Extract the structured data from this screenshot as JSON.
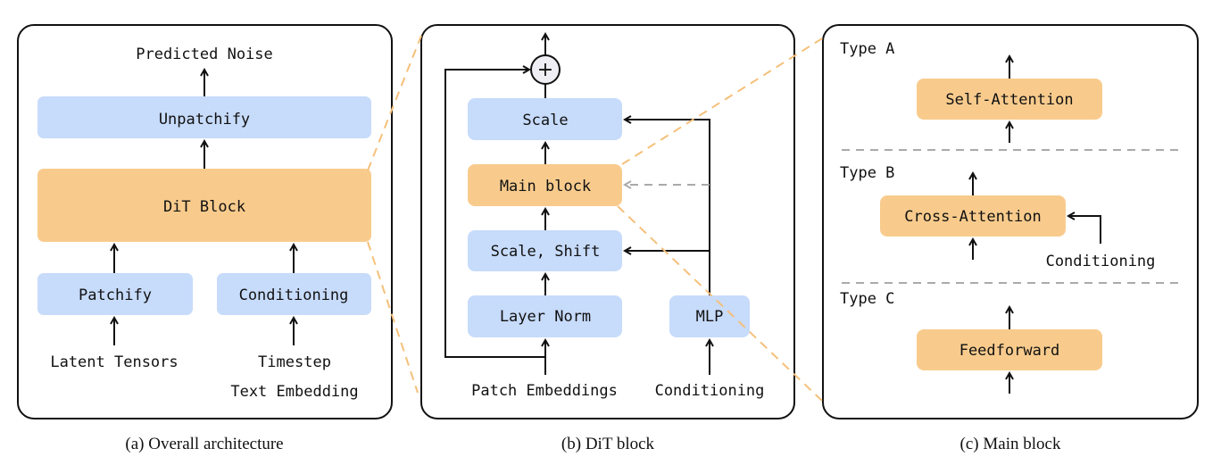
{
  "panel_a": {
    "caption": "(a) Overall architecture",
    "output_label": "Predicted Noise",
    "unpatchify": "Unpatchify",
    "dit_block": "DiT Block",
    "patchify": "Patchify",
    "conditioning": "Conditioning",
    "input_latent": "Latent Tensors",
    "input_timestep": "Timestep",
    "input_text": "Text Embedding"
  },
  "panel_b": {
    "caption": "(b) DiT block",
    "plus": "+",
    "scale": "Scale",
    "main_block": "Main block",
    "scale_shift": "Scale, Shift",
    "layer_norm": "Layer Norm",
    "mlp": "MLP",
    "input_patch": "Patch Embeddings",
    "input_cond": "Conditioning"
  },
  "panel_c": {
    "caption": "(c) Main block",
    "type_a": "Type A",
    "self_attention": "Self-Attention",
    "type_b": "Type B",
    "cross_attention": "Cross-Attention",
    "conditioning": "Conditioning",
    "type_c": "Type C",
    "feedforward": "Feedforward"
  },
  "colors": {
    "blue_block": "#c7dbfb",
    "orange_block": "#f8cb8d",
    "connector": "#f5c07a",
    "gray_dash": "#aaaaaa"
  }
}
